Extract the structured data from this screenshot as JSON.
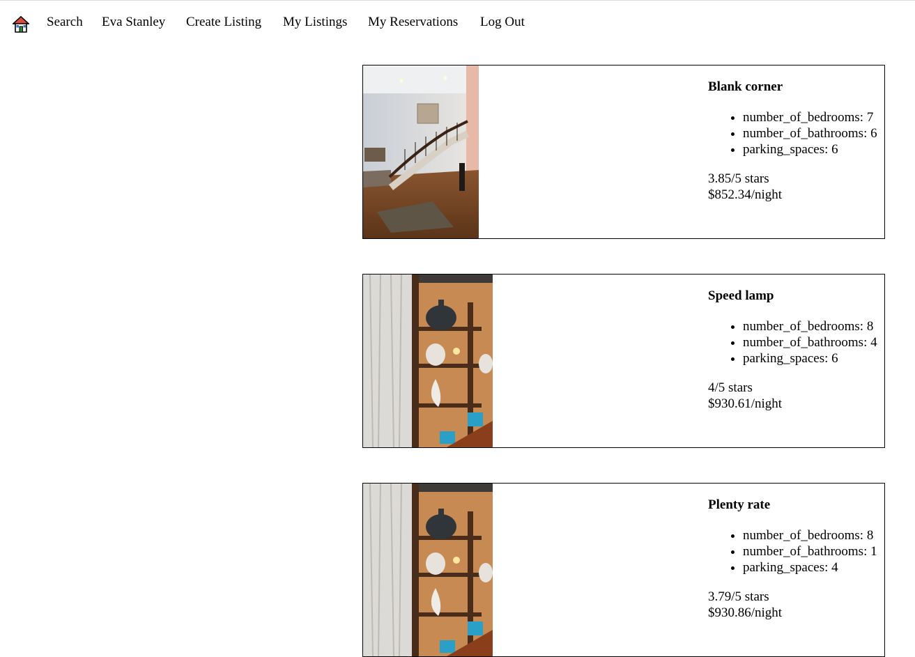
{
  "nav": {
    "home_icon": "house-icon",
    "links": [
      "Search",
      "Eva Stanley",
      "Create Listing",
      "My Listings",
      "My Reservations",
      "Log Out"
    ]
  },
  "listings": [
    {
      "title": "Blank corner",
      "features": [
        "number_of_bedrooms: 7",
        "number_of_bathrooms: 6",
        "parking_spaces: 6"
      ],
      "rating": "3.85/5 stars",
      "price": "$852.34/night",
      "image": "staircase-interior-photo"
    },
    {
      "title": "Speed lamp",
      "features": [
        "number_of_bedrooms: 8",
        "number_of_bathrooms: 4",
        "parking_spaces: 6"
      ],
      "rating": "4/5 stars",
      "price": "$930.61/night",
      "image": "shelf-decor-photo"
    },
    {
      "title": "Plenty rate",
      "features": [
        "number_of_bedrooms: 8",
        "number_of_bathrooms: 1",
        "parking_spaces: 4"
      ],
      "rating": "3.79/5 stars",
      "price": "$930.86/night",
      "image": "shelf-decor-photo"
    }
  ]
}
